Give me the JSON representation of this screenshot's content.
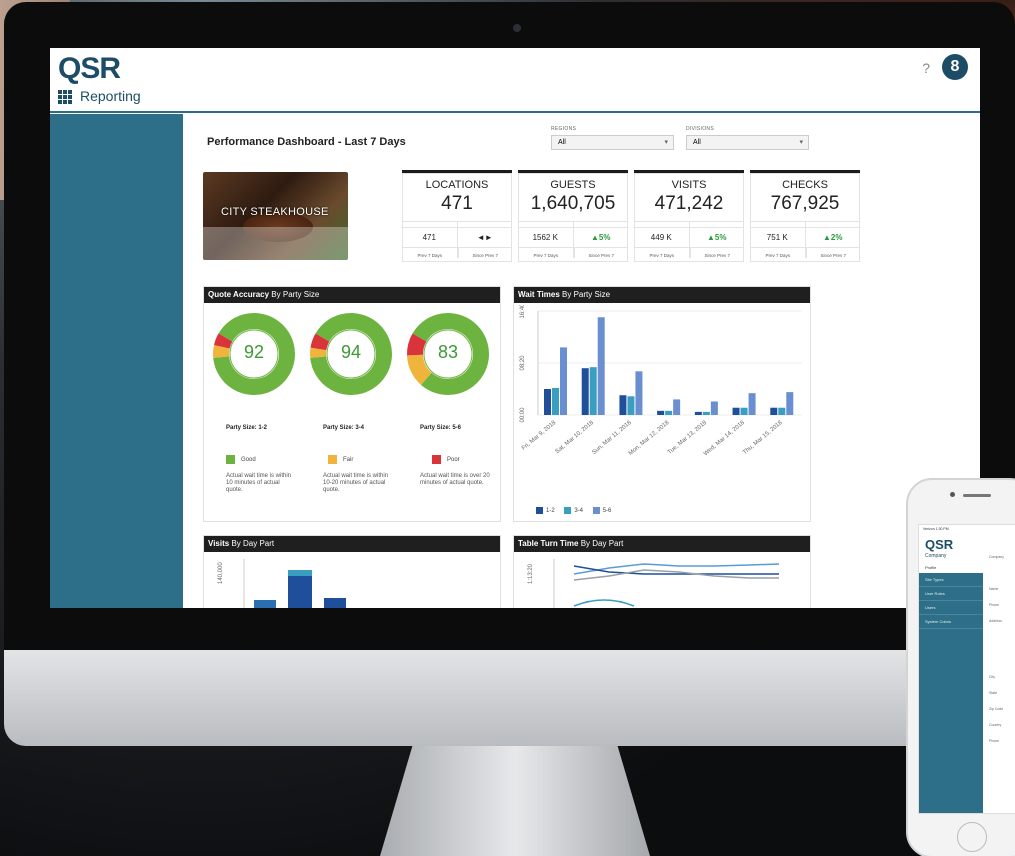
{
  "app": {
    "logo": "QSR",
    "section": "Reporting",
    "help": "?",
    "user_icon": "8"
  },
  "dashboard": {
    "title": "Performance Dashboard - Last 7 Days",
    "filters": [
      {
        "label": "REGIONS",
        "value": "All"
      },
      {
        "label": "DIVISIONS",
        "value": "All"
      }
    ],
    "hero_label": "CITY STEAKHOUSE",
    "stats": [
      {
        "title": "LOCATIONS",
        "value": "471",
        "prev": "471",
        "prev_caption": "Prev 7 Days",
        "change": "◄►",
        "change_caption": "Since Prev 7"
      },
      {
        "title": "GUESTS",
        "value": "1,640,705",
        "prev": "1562 K",
        "prev_caption": "Prev 7 Days",
        "change": "▲5%",
        "change_caption": "Since Prev 7"
      },
      {
        "title": "VISITS",
        "value": "471,242",
        "prev": "449 K",
        "prev_caption": "Prev 7 Days",
        "change": "▲5%",
        "change_caption": "Since Prev 7"
      },
      {
        "title": "CHECKS",
        "value": "767,925",
        "prev": "751 K",
        "prev_caption": "Prev 7 Days",
        "change": "▲2%",
        "change_caption": "Since Prev 7"
      }
    ]
  },
  "quote_accuracy": {
    "title_bold": "Quote Accuracy",
    "title_rest": "By Party Size",
    "donuts": [
      {
        "value": "92",
        "label": "Party Size: 1-2",
        "good": 0.9,
        "fair": 0.05,
        "poor": 0.05
      },
      {
        "value": "94",
        "label": "Party Size: 3-4",
        "good": 0.9,
        "fair": 0.04,
        "poor": 0.06
      },
      {
        "value": "83",
        "label": "Party Size: 5-6",
        "good": 0.78,
        "fair": 0.13,
        "poor": 0.09
      }
    ],
    "legend": [
      {
        "name": "Good",
        "color": "#6cb43f",
        "desc": "Actual wait time is within 10 minutes of actual quote."
      },
      {
        "name": "Fair",
        "color": "#f0b43c",
        "desc": "Actual wait time is within 10-20 minutes of actual quote."
      },
      {
        "name": "Poor",
        "color": "#d8343a",
        "desc": "Actual wait time is over 20 minutes of actual quote."
      }
    ]
  },
  "wait_times": {
    "title_bold": "Wait Times",
    "title_rest": "By Party Size",
    "y_ticks": [
      "00:00",
      "08:20",
      "16:40"
    ],
    "legend": [
      "1-2",
      "3-4",
      "5-6"
    ],
    "colors": [
      "#1f4e9a",
      "#3a9ec0",
      "#6a8fd0"
    ]
  },
  "visits_panel": {
    "title_bold": "Visits",
    "title_rest": "By Day Part",
    "y_tick": "140,000"
  },
  "turn_panel": {
    "title_bold": "Table Turn Time",
    "title_rest": "By Day Part",
    "y_tick": "1:13:20"
  },
  "chart_data": {
    "type": "bar",
    "title": "Wait Times By Party Size",
    "categories": [
      "Fri, Mar 9, 2018",
      "Sat, Mar 10, 2018",
      "Sun, Mar 11, 2018",
      "Mon, Mar 12, 2018",
      "Tue, Mar 13, 2018",
      "Wed, Mar 14, 2018",
      "Thu, Mar 15, 2018"
    ],
    "series": [
      {
        "name": "1-2",
        "values": [
          250,
          450,
          190,
          40,
          30,
          70,
          70
        ]
      },
      {
        "name": "3-4",
        "values": [
          260,
          460,
          180,
          40,
          30,
          70,
          70
        ]
      },
      {
        "name": "5-6",
        "values": [
          650,
          940,
          420,
          150,
          130,
          210,
          220
        ]
      }
    ],
    "ylim": [
      0,
      1000
    ]
  },
  "phone": {
    "status": "Verizon  1:30 PM",
    "logo": "QSR",
    "company": "Company",
    "profile": "Profile",
    "menu": [
      "Site Types",
      "User Roles",
      "Users",
      "System Colors"
    ],
    "right": [
      "Company",
      "Name",
      "Phone",
      "Address",
      "City",
      "State",
      "Zip Code",
      "Country",
      "Phone"
    ]
  }
}
